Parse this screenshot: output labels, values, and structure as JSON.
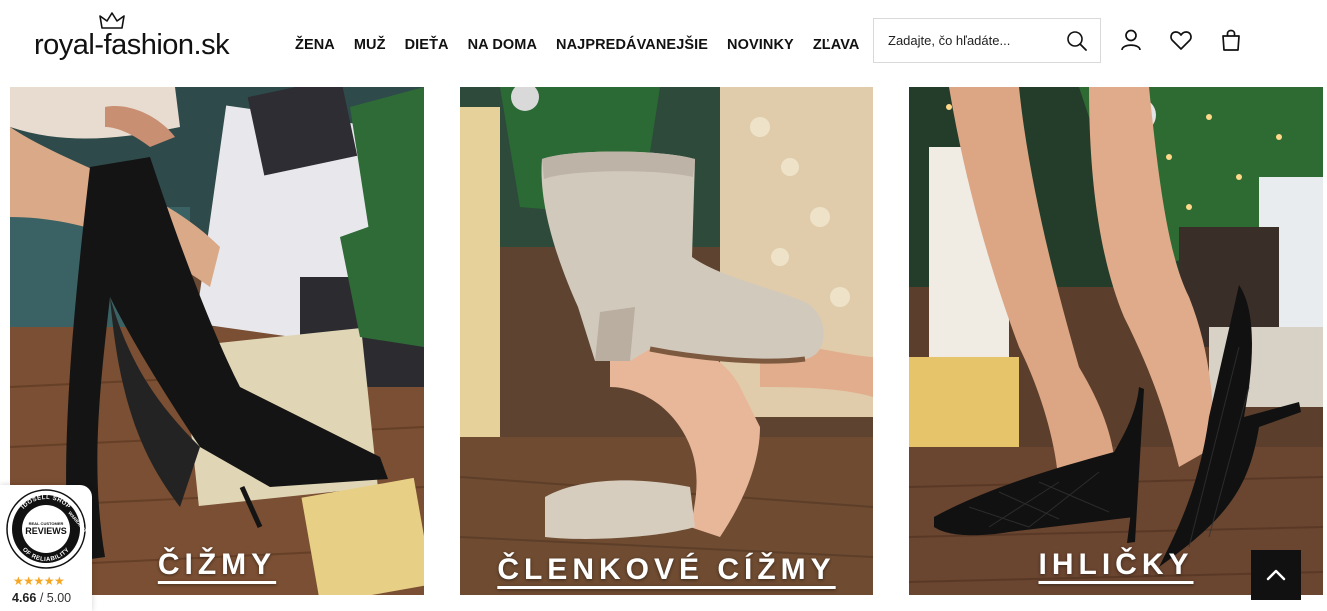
{
  "header": {
    "logo_text": "royal-fashion.sk",
    "nav": [
      {
        "label": "ŽENA"
      },
      {
        "label": "MUŽ"
      },
      {
        "label": "DIEŤA"
      },
      {
        "label": "NA DOMA"
      },
      {
        "label": "NAJPREDÁVANEJŠIE"
      },
      {
        "label": "NOVINKY"
      },
      {
        "label": "ZĽAVA"
      }
    ],
    "search": {
      "placeholder": "Zadajte, čo hľadáte...",
      "value": "",
      "icon": "search-icon"
    },
    "icons": [
      "user-icon",
      "heart-icon",
      "bag-icon"
    ]
  },
  "tiles": [
    {
      "label": "ČIŽMY"
    },
    {
      "label": "ČLENKOVÉ CÍŽMY"
    },
    {
      "label": "IHLIČKY"
    }
  ],
  "badge": {
    "ring_top": "IDOSELL SHOP",
    "ring_right": "WARRANTY",
    "ring_bottom": "OF RELIABILITY",
    "inner_small": "REAL CUSTOMER",
    "inner_big": "REVIEWS",
    "stars": "★★★★★",
    "score": "4.66",
    "max": "/ 5.00"
  },
  "colors": {
    "accent": "#111111",
    "star": "#f5a623"
  }
}
